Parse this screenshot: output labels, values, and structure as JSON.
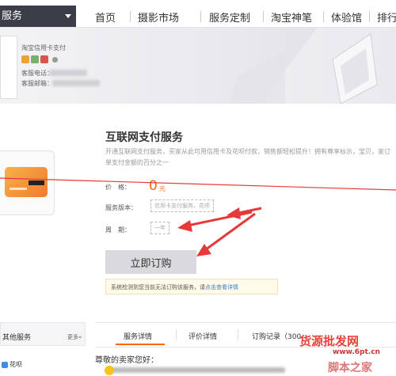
{
  "nav": {
    "brand": "服务",
    "links": [
      "首页",
      "摄影市场",
      "服务定制",
      "淘宝神笔",
      "体验馆",
      "排行"
    ]
  },
  "shop": {
    "name": "淘宝信用卡支付",
    "phone_label": "客服电话：",
    "email_label": "客服邮箱："
  },
  "product": {
    "title": "互联网支付服务",
    "description": "开通互联网支付服务，买家从此可用信用卡及花呗付款，销售额轻松提升！拥有尊享标示，宝贝，家订单支付金额的百分之一",
    "price_label": "价　格：",
    "price": "0",
    "price_unit": "元",
    "version_label": "服务版本：",
    "version_value": "信用卡支付服务、花呗",
    "period_label": "周　期：",
    "period_value": "一年",
    "buy_label": "立即订购",
    "notice_text": "系统检测到您当前无法订购该服务，请",
    "notice_link": "点击查看详情"
  },
  "sidebar": {
    "title": "其他服务",
    "more": "更多»",
    "item": "花呗"
  },
  "tabs": [
    "服务详情",
    "评价详情",
    "订购记录（300"
  ],
  "greeting": "尊敬的卖家您好：",
  "watermark": {
    "line1": "货源批发网",
    "line2": "www.6pt.cn",
    "line3": "脚本之家"
  },
  "colors": {
    "accent": "#ff6600",
    "annotation": "#e63a3a",
    "brand_bar": "#3b3d49"
  }
}
